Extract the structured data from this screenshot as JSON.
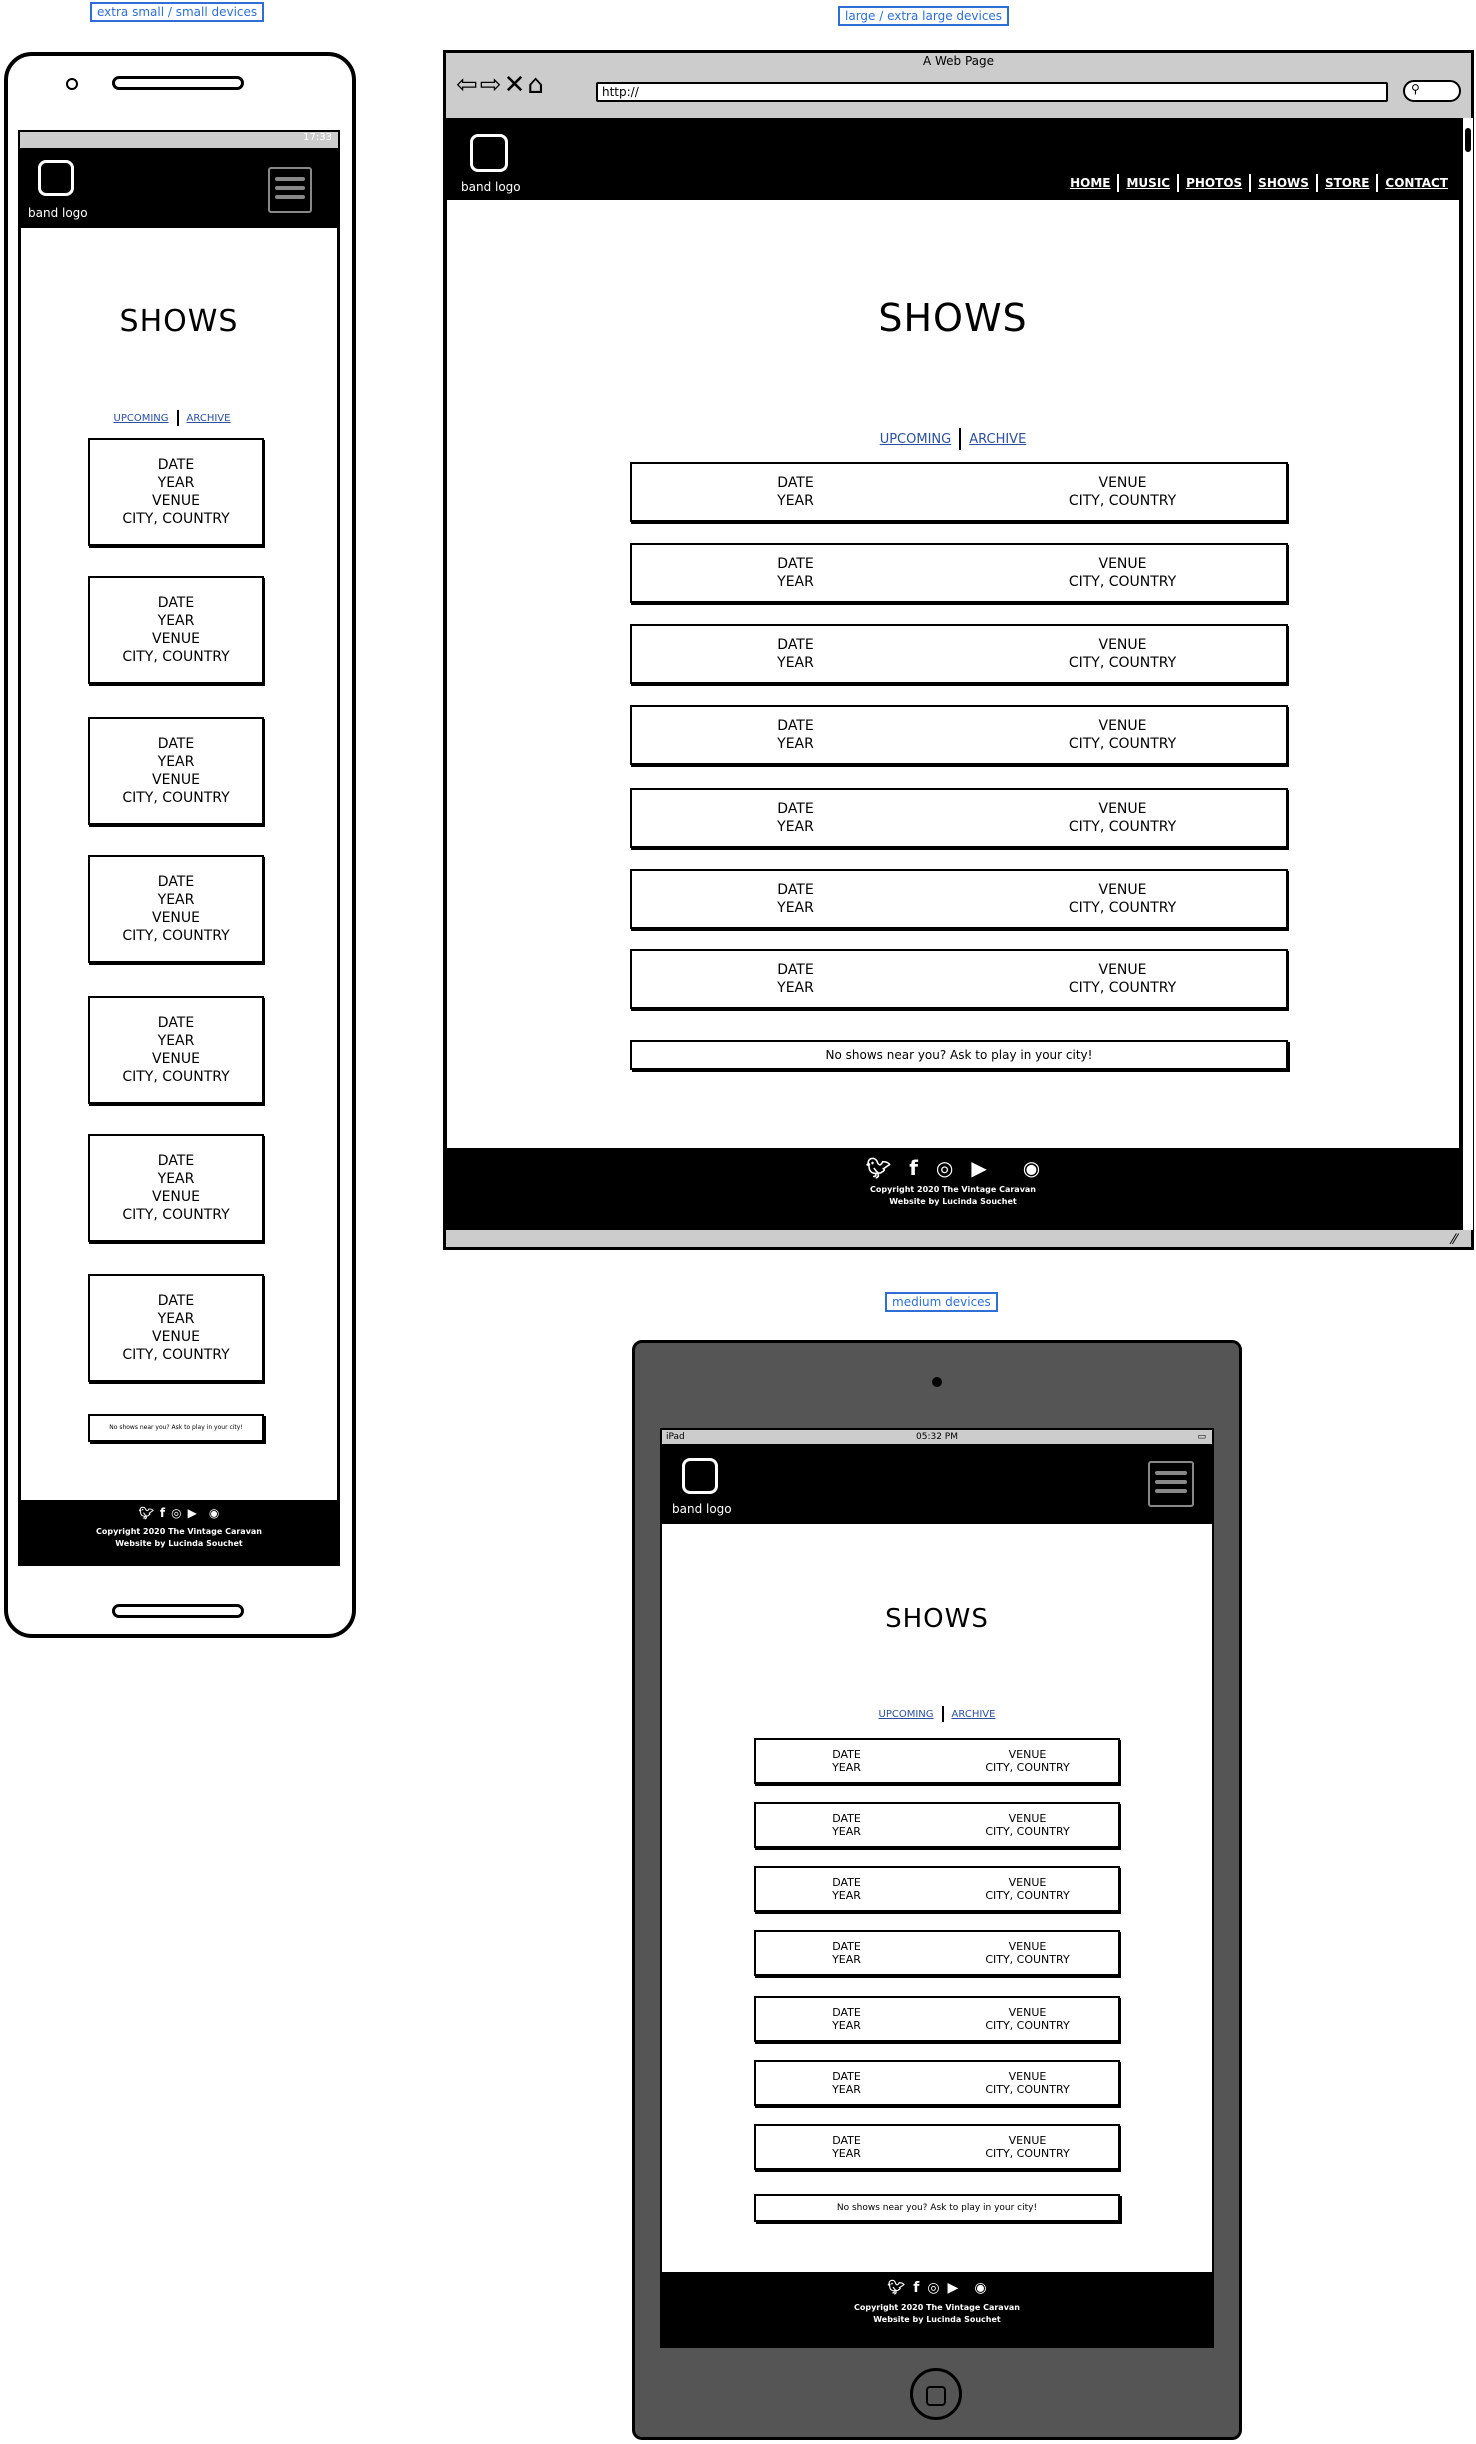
{
  "labels": {
    "small": "extra small / small devices",
    "large": "large / extra large devices",
    "medium": "medium devices"
  },
  "phone": {
    "time": "17:33"
  },
  "browser": {
    "window_title": "A Web Page",
    "url": "http://"
  },
  "tablet": {
    "carrier": "iPad",
    "time": "05:32 PM"
  },
  "site": {
    "logo_label": "band logo",
    "page_title": "SHOWS",
    "nav": [
      "HOME",
      "MUSIC",
      "PHOTOS",
      "SHOWS",
      "STORE",
      "CONTACT"
    ],
    "tab_upcoming": "UPCOMING",
    "tab_archive": "ARCHIVE",
    "show": {
      "date": "DATE",
      "year": "YEAR",
      "venue": "VENUE",
      "location": "CITY, COUNTRY"
    },
    "ask": "No shows near you? Ask to play in your city!",
    "copyright": "Copyright 2020 The Vintage Caravan",
    "credit": "Website by Lucinda Souchet"
  },
  "social_icons": [
    "twitter-icon",
    "facebook-icon",
    "instagram-icon",
    "youtube-icon",
    "apple-icon",
    "spotify-icon"
  ]
}
